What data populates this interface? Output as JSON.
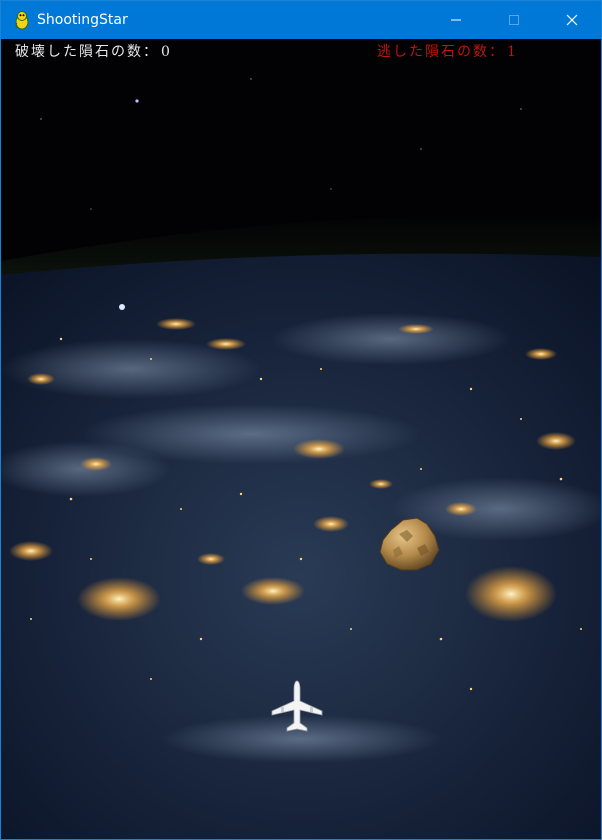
{
  "window": {
    "title": "ShootingStar",
    "icon": "pygame-snake-icon",
    "controls": {
      "minimize_icon": "minimize-icon",
      "maximize_icon": "maximize-icon",
      "close_icon": "close-icon"
    },
    "accent_color": "#0078d7"
  },
  "hud": {
    "destroyed_label": "破壊した隕石の数：",
    "destroyed_count": "0",
    "missed_label": "逃した隕石の数：",
    "missed_count": "1",
    "destroyed_color": "#e8e8e8",
    "missed_color": "#c0140f"
  },
  "scene": {
    "background": "earth-at-night-from-orbit",
    "meteor": "meteor-rock",
    "player": "airplane-player"
  }
}
